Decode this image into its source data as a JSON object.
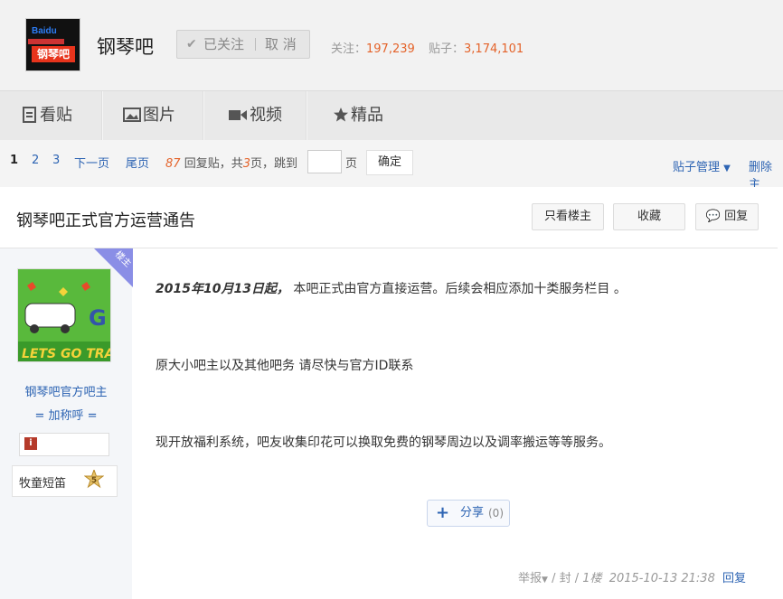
{
  "header": {
    "logo_top": "Baidu",
    "logo_bottom": "钢琴吧",
    "forum_name": "钢琴吧",
    "follow_label": "已关注",
    "unfollow_label": "取 消",
    "follow_count_label": "关注：",
    "follow_count": "197,239",
    "post_count_label": "贴子：",
    "post_count": "3,174,101"
  },
  "nav": {
    "items": [
      {
        "label": "看贴",
        "icon": "document-icon"
      },
      {
        "label": "图片",
        "icon": "image-icon"
      },
      {
        "label": "视频",
        "icon": "video-icon"
      },
      {
        "label": "精品",
        "icon": "star-icon"
      }
    ]
  },
  "pager": {
    "current": "1",
    "pages": [
      "2",
      "3"
    ],
    "next": "下一页",
    "last": "尾页",
    "reply_count": "87",
    "reply_text": "回复贴，共",
    "total_pages": "3",
    "total_suffix": "页，跳到",
    "page_unit": "页",
    "confirm": "确定",
    "manage": "贴子管理",
    "delete_partial": "删除主"
  },
  "post": {
    "title": "钢琴吧正式官方运营通告",
    "only_op": "只看楼主",
    "favorite": "收藏",
    "reply": "回复",
    "op_tag": "楼主",
    "paragraphs": [
      {
        "lead": "2015年10月13日起，",
        "text": " 本吧正式由官方直接运营。后续会相应添加十类服务栏目 。"
      },
      {
        "lead": "",
        "text": "原大小吧主以及其他吧务 请尽快与官方ID联系"
      },
      {
        "lead": "",
        "text": "现开放福利系统，吧友收集印花可以换取免费的钢琴周边以及调率搬运等等服务。"
      }
    ],
    "share_label": "分享",
    "share_count": "(0)",
    "footer": {
      "report": "举报",
      "ban": "封",
      "floor": "1楼",
      "time": "2015-10-13 21:38",
      "reply": "回复"
    }
  },
  "author": {
    "avatar_text": "LETS GO TRA",
    "name": "钢琴吧官方吧主",
    "nick": "= 加称呼 =",
    "badge_icon": "i",
    "level_name": "牧童短笛",
    "level": "5"
  },
  "colors": {
    "link": "#2d64b3",
    "accent": "#e4632a",
    "op_tag": "#8a8ee6"
  }
}
